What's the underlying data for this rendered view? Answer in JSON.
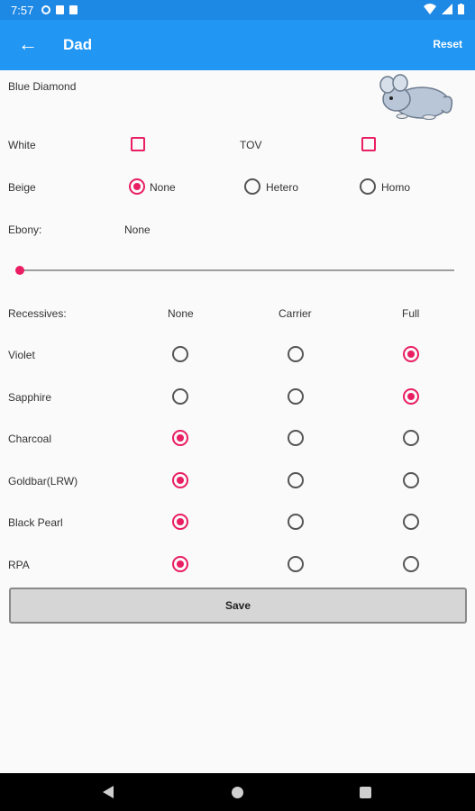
{
  "status": {
    "time": "7:57"
  },
  "appbar": {
    "title": "Dad",
    "reset_label": "Reset"
  },
  "form": {
    "color_name": "Blue Diamond",
    "white_label": "White",
    "white_checked": false,
    "tov_label": "TOV",
    "tov_checked": false,
    "beige_label": "Beige",
    "beige_options": [
      "None",
      "Hetero",
      "Homo"
    ],
    "beige_selected": "None",
    "ebony_label": "Ebony:",
    "ebony_value": "None",
    "ebony_level": 0,
    "recessives_label": "Recessives:",
    "recessive_columns": [
      "None",
      "Carrier",
      "Full"
    ],
    "recessives": [
      {
        "name": "Violet",
        "selected": "Full"
      },
      {
        "name": "Sapphire",
        "selected": "Full"
      },
      {
        "name": "Charcoal",
        "selected": "None"
      },
      {
        "name": "Goldbar(LRW)",
        "selected": "None"
      },
      {
        "name": "Black Pearl",
        "selected": "None"
      },
      {
        "name": "RPA",
        "selected": "None"
      }
    ],
    "save_label": "Save"
  }
}
